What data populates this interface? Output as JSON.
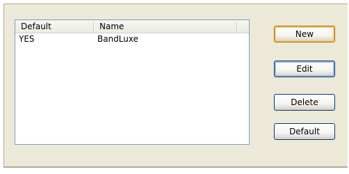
{
  "list": {
    "columns": [
      "Default",
      "Name"
    ],
    "rows": [
      {
        "default": "YES",
        "name": "BandLuxe"
      }
    ]
  },
  "buttons": {
    "new": "New",
    "edit": "Edit",
    "delete": "Delete",
    "default": "Default"
  }
}
